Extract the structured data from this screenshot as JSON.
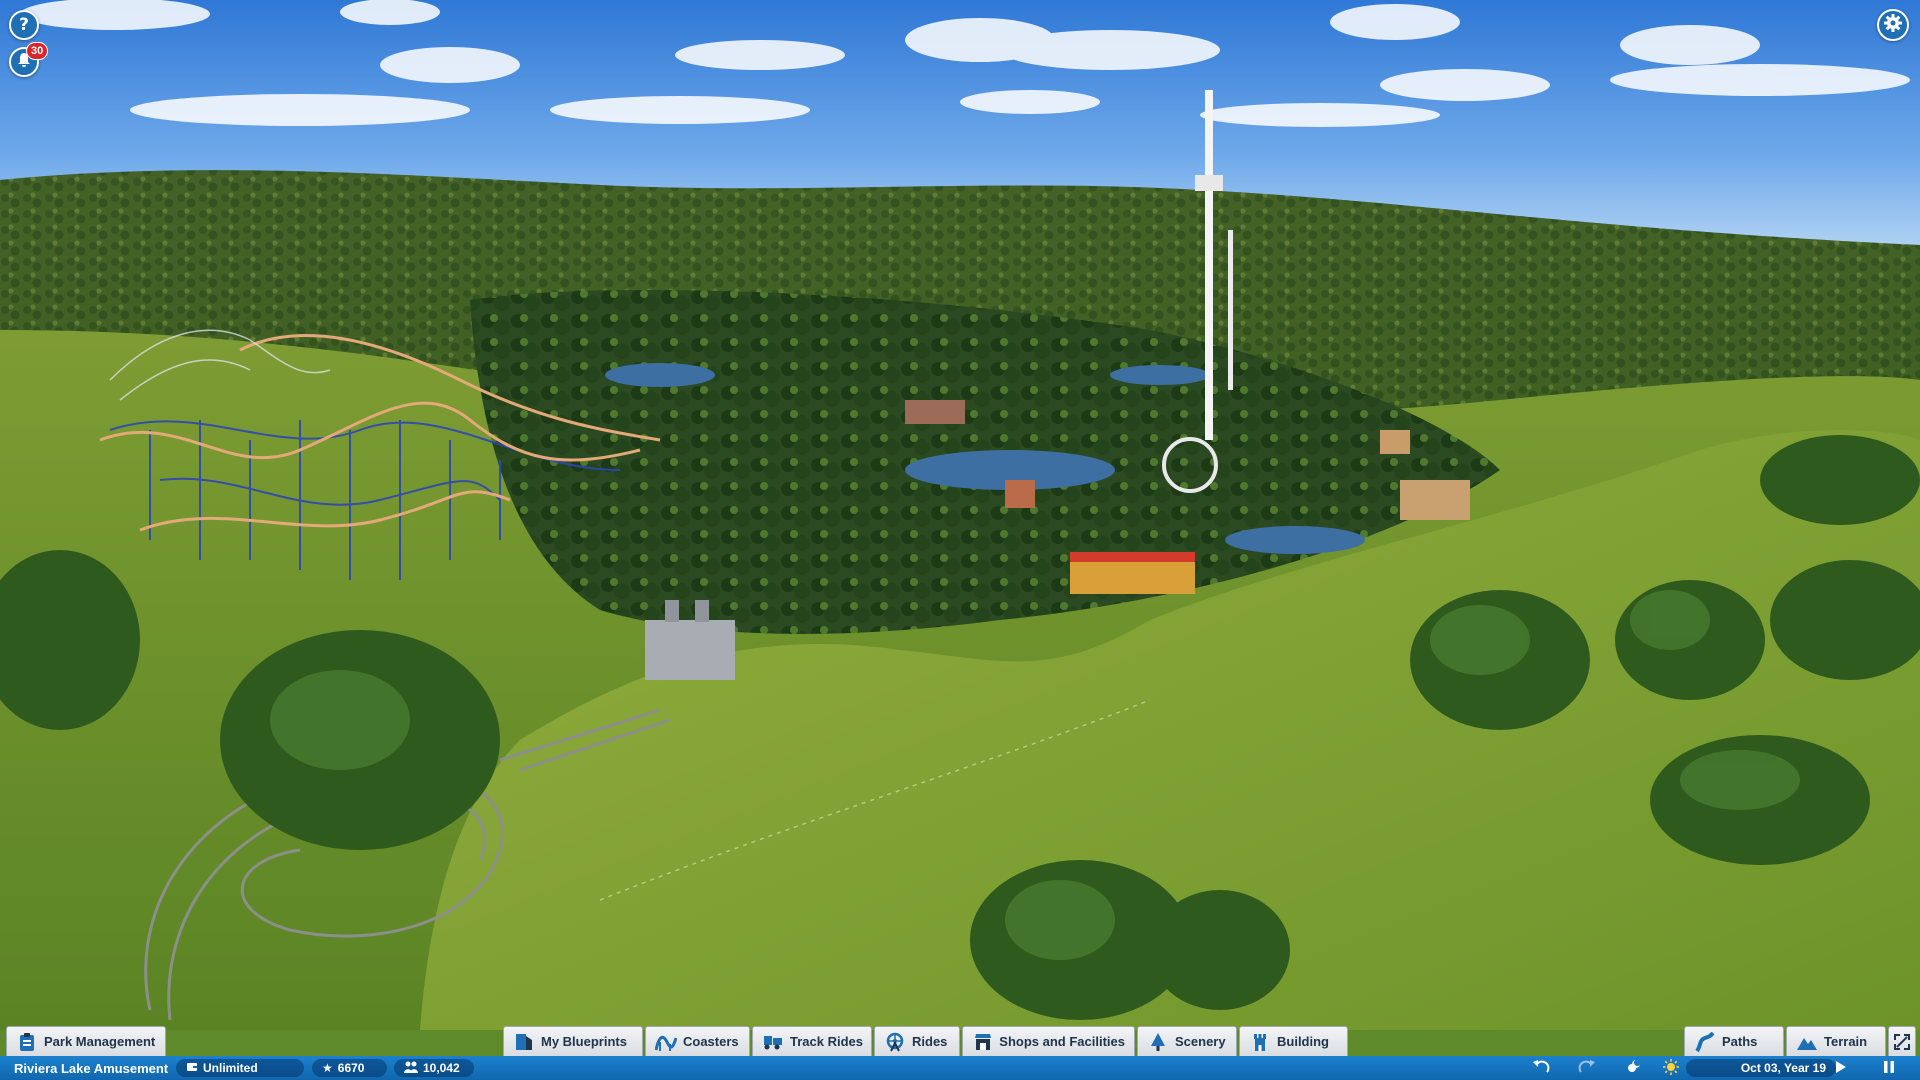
{
  "window": {
    "help_label": "?",
    "notification_count": "30"
  },
  "icons": {
    "help": "help-icon",
    "notifications": "bell-icon",
    "settings": "gear-icon"
  },
  "menu": {
    "park_management": "Park Management",
    "my_blueprints": "My Blueprints",
    "coasters": "Coasters",
    "track_rides": "Track Rides",
    "rides": "Rides",
    "shops_and_facilities": "Shops and Facilities",
    "scenery": "Scenery",
    "building": "Building",
    "paths": "Paths",
    "terrain": "Terrain"
  },
  "status": {
    "park_name": "Riviera Lake Amusement",
    "money": "Unlimited",
    "rating": "6670",
    "guests": "10,042",
    "date": "Oct 03, Year 19"
  },
  "colors": {
    "menu_text": "#20344c",
    "status_bar": "#1673bd",
    "badge": "#d8262b",
    "button_blue": "#1f6fb5"
  }
}
